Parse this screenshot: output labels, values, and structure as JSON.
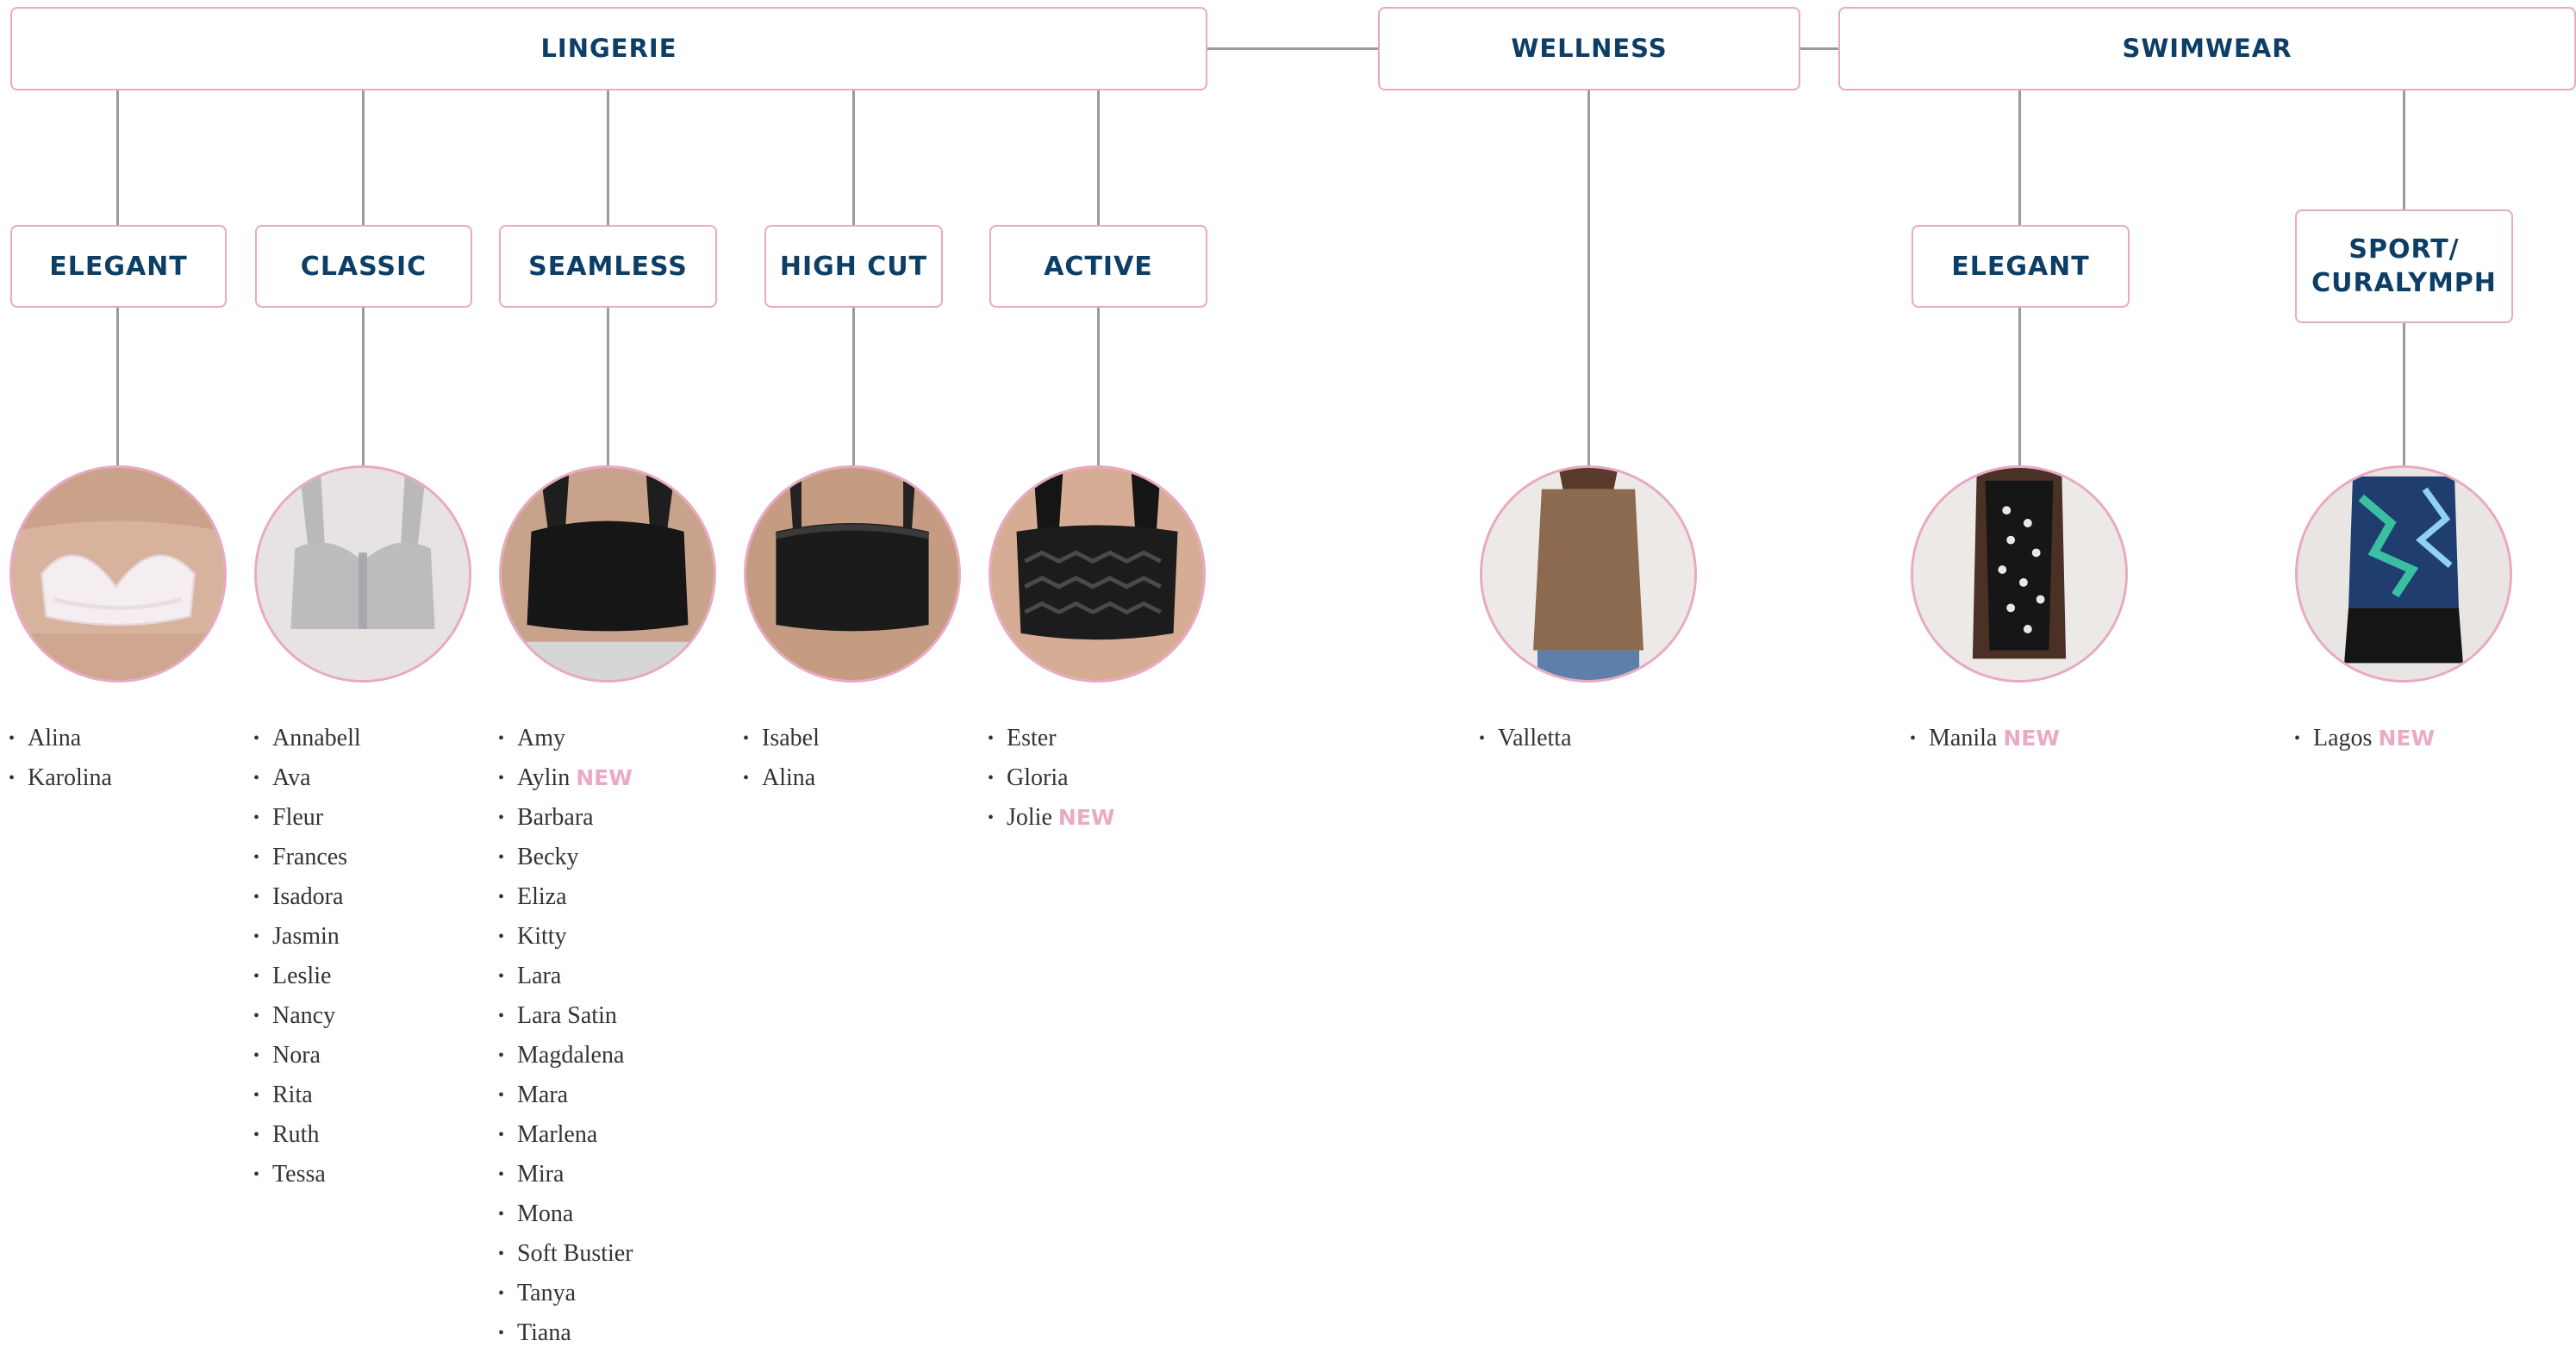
{
  "new_label": "NEW",
  "colors": {
    "heading": "#0d3e66",
    "border": "#e9a9c3",
    "connector": "#9b9b9b",
    "new_badge": "#eba9c6"
  },
  "categories": {
    "lingerie": "LINGERIE",
    "wellness": "WELLNESS",
    "swimwear": "SWIMWEAR"
  },
  "subcategories": {
    "elegant_lingerie": "ELEGANT",
    "classic": "CLASSIC",
    "seamless": "SEAMLESS",
    "high_cut": "HIGH CUT",
    "active": "ACTIVE",
    "elegant_swim": "ELEGANT",
    "sport_line1": "SPORT/",
    "sport_line2": "CURALYMPH"
  },
  "products": {
    "elegant_lingerie": [
      {
        "name": "Alina",
        "new": false
      },
      {
        "name": "Karolina",
        "new": false
      }
    ],
    "classic": [
      {
        "name": "Annabell",
        "new": false
      },
      {
        "name": "Ava",
        "new": false
      },
      {
        "name": "Fleur",
        "new": false
      },
      {
        "name": "Frances",
        "new": false
      },
      {
        "name": "Isadora",
        "new": false
      },
      {
        "name": "Jasmin",
        "new": false
      },
      {
        "name": "Leslie",
        "new": false
      },
      {
        "name": "Nancy",
        "new": false
      },
      {
        "name": "Nora",
        "new": false
      },
      {
        "name": "Rita",
        "new": false
      },
      {
        "name": "Ruth",
        "new": false
      },
      {
        "name": "Tessa",
        "new": false
      }
    ],
    "seamless": [
      {
        "name": "Amy",
        "new": false
      },
      {
        "name": "Aylin",
        "new": true
      },
      {
        "name": "Barbara",
        "new": false
      },
      {
        "name": "Becky",
        "new": false
      },
      {
        "name": "Eliza",
        "new": false
      },
      {
        "name": "Kitty",
        "new": false
      },
      {
        "name": "Lara",
        "new": false
      },
      {
        "name": "Lara Satin",
        "new": false
      },
      {
        "name": "Magdalena",
        "new": false
      },
      {
        "name": "Mara",
        "new": false
      },
      {
        "name": "Marlena",
        "new": false
      },
      {
        "name": "Mira",
        "new": false
      },
      {
        "name": "Mona",
        "new": false
      },
      {
        "name": "Soft Bustier",
        "new": false
      },
      {
        "name": "Tanya",
        "new": false
      },
      {
        "name": "Tiana",
        "new": false
      }
    ],
    "high_cut": [
      {
        "name": "Isabel",
        "new": false
      },
      {
        "name": "Alina",
        "new": false
      }
    ],
    "active": [
      {
        "name": "Ester",
        "new": false
      },
      {
        "name": "Gloria",
        "new": false
      },
      {
        "name": "Jolie",
        "new": true
      }
    ],
    "wellness": [
      {
        "name": "Valletta",
        "new": false
      }
    ],
    "elegant_swim": [
      {
        "name": "Manila",
        "new": true
      }
    ],
    "sport": [
      {
        "name": "Lagos",
        "new": true
      }
    ]
  }
}
